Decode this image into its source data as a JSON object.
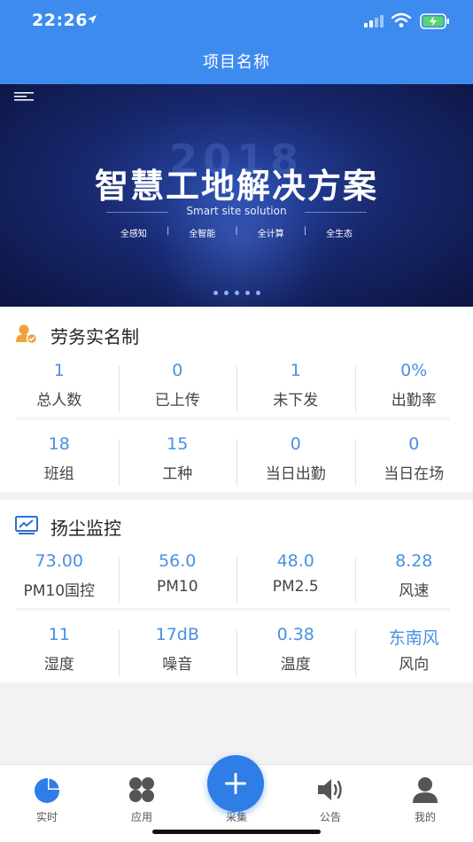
{
  "status_bar": {
    "time": "22:26"
  },
  "nav": {
    "title": "项目名称"
  },
  "banner": {
    "year_watermark": "2018",
    "headline": "智慧工地解决方案",
    "subline": "Smart site solution",
    "tags": [
      "全感知",
      "全智能",
      "全计算",
      "全生态"
    ],
    "separator": "|",
    "page_count": 5
  },
  "labor": {
    "title": "劳务实名制",
    "row1": [
      {
        "value": "1",
        "label": "总人数"
      },
      {
        "value": "0",
        "label": "已上传"
      },
      {
        "value": "1",
        "label": "未下发"
      },
      {
        "value": "0%",
        "label": "出勤率"
      }
    ],
    "row2": [
      {
        "value": "18",
        "label": "班组"
      },
      {
        "value": "15",
        "label": "工种"
      },
      {
        "value": "0",
        "label": "当日出勤"
      },
      {
        "value": "0",
        "label": "当日在场"
      }
    ]
  },
  "dust": {
    "title": "扬尘监控",
    "row1": [
      {
        "value": "73.00",
        "label": "PM10国控"
      },
      {
        "value": "56.0",
        "label": "PM10"
      },
      {
        "value": "48.0",
        "label": "PM2.5"
      },
      {
        "value": "8.28",
        "label": "风速"
      }
    ],
    "row2": [
      {
        "value": "11",
        "label": "湿度"
      },
      {
        "value": "17dB",
        "label": "噪音"
      },
      {
        "value": "0.38",
        "label": "温度"
      },
      {
        "value": "东南风",
        "label": "风向"
      }
    ]
  },
  "tabs": {
    "realtime": "实时",
    "apps": "应用",
    "collect": "采集",
    "notice": "公告",
    "mine": "我的"
  },
  "colors": {
    "nav_blue": "#3d8bef",
    "value_blue": "#4a90e2",
    "fab_blue": "#2f7de6",
    "labor_icon_orange": "#f0a13c"
  }
}
